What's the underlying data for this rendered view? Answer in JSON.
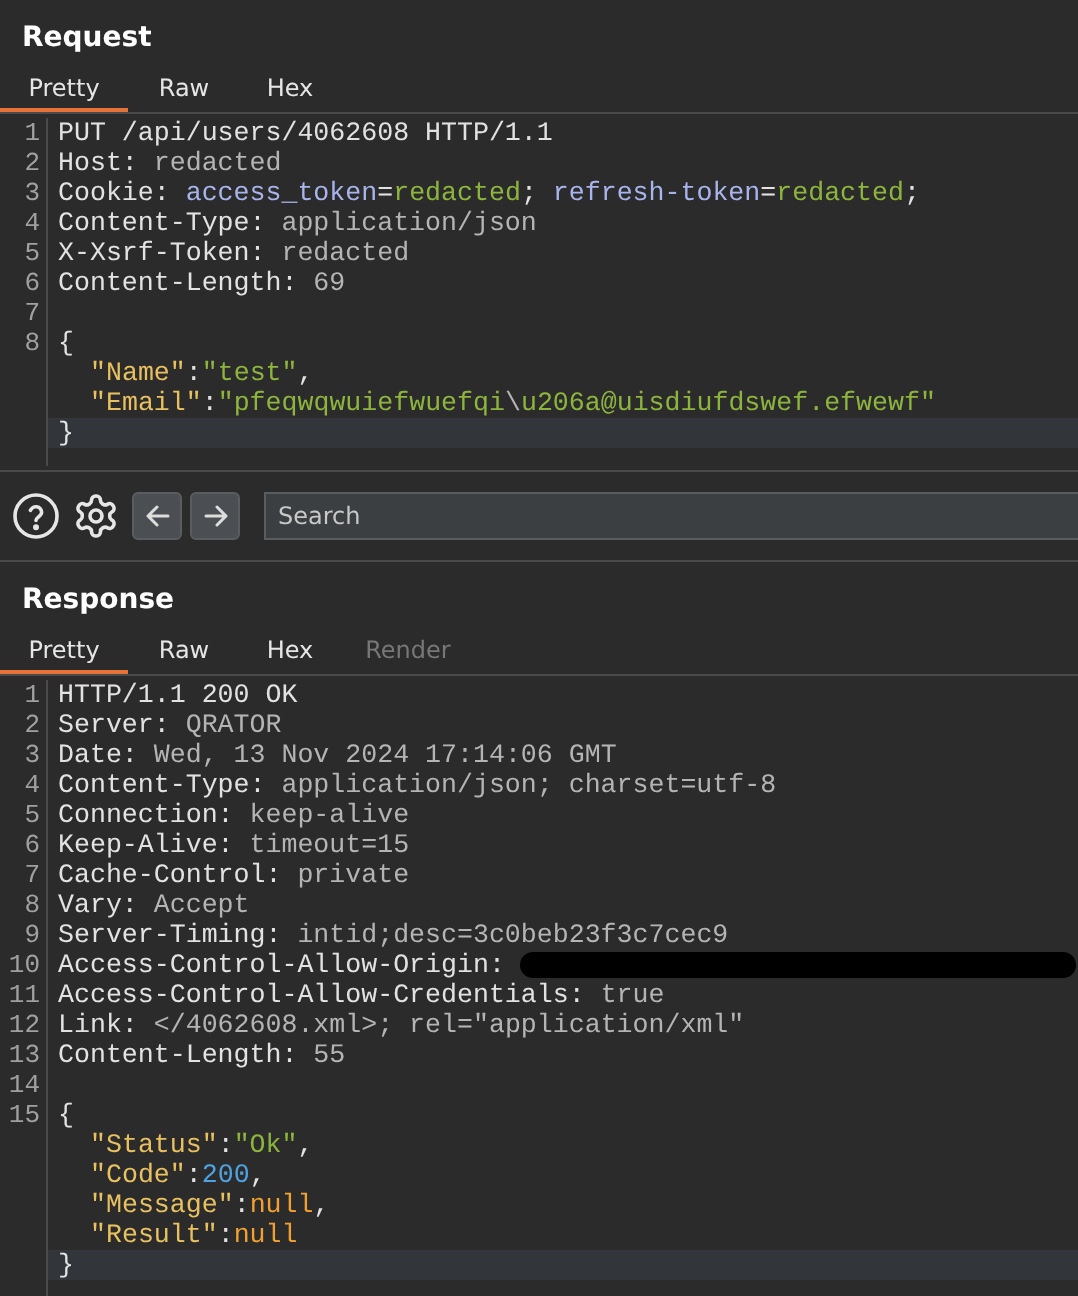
{
  "request": {
    "title": "Request",
    "tabs": [
      {
        "label": "Pretty",
        "selected": true,
        "disabled": false
      },
      {
        "label": "Raw",
        "selected": false,
        "disabled": false
      },
      {
        "label": "Hex",
        "selected": false,
        "disabled": false
      }
    ],
    "lines": [
      {
        "number": "1",
        "current": false,
        "indent": false,
        "segments": [
          {
            "kind": "key",
            "text": "PUT /api/users/4062608 HTTP/1.1"
          }
        ]
      },
      {
        "number": "2",
        "current": false,
        "indent": false,
        "segments": [
          {
            "kind": "key",
            "text": "Host: "
          },
          {
            "kind": "value",
            "text": "redacted"
          }
        ]
      },
      {
        "number": "3",
        "current": false,
        "indent": false,
        "segments": [
          {
            "kind": "key",
            "text": "Cookie: "
          },
          {
            "kind": "param",
            "text": "access_token"
          },
          {
            "kind": "key",
            "text": "="
          },
          {
            "kind": "string",
            "text": "redacted"
          },
          {
            "kind": "key",
            "text": "; "
          },
          {
            "kind": "param",
            "text": "refresh-token"
          },
          {
            "kind": "key",
            "text": "="
          },
          {
            "kind": "string",
            "text": "redacted"
          },
          {
            "kind": "key",
            "text": ";"
          }
        ]
      },
      {
        "number": "4",
        "current": false,
        "indent": false,
        "segments": [
          {
            "kind": "key",
            "text": "Content-Type: "
          },
          {
            "kind": "value",
            "text": "application/json"
          }
        ]
      },
      {
        "number": "5",
        "current": false,
        "indent": false,
        "segments": [
          {
            "kind": "key",
            "text": "X-Xsrf-Token: "
          },
          {
            "kind": "value",
            "text": "redacted"
          }
        ]
      },
      {
        "number": "6",
        "current": false,
        "indent": false,
        "segments": [
          {
            "kind": "key",
            "text": "Content-Length: "
          },
          {
            "kind": "value",
            "text": "69"
          }
        ]
      },
      {
        "number": "7",
        "current": false
      },
      {
        "number": "8",
        "current": false,
        "indent": false,
        "segments": [
          {
            "kind": "key",
            "text": "{"
          }
        ]
      },
      {
        "current": false,
        "indent": true,
        "segments": [
          {
            "kind": "name",
            "text": "\"Name\""
          },
          {
            "kind": "key",
            "text": ":"
          },
          {
            "kind": "string",
            "text": "\"test\""
          },
          {
            "kind": "key",
            "text": ","
          }
        ]
      },
      {
        "current": false,
        "indent": true,
        "segments": [
          {
            "kind": "name",
            "text": "\"Email\""
          },
          {
            "kind": "key",
            "text": ":"
          },
          {
            "kind": "string",
            "text": "\"pfeqwqwuiefwuefqi"
          },
          {
            "kind": "value",
            "text": "\\"
          },
          {
            "kind": "string",
            "text": "u206a@uisdiufdswef.efwewf\""
          }
        ]
      },
      {
        "current": true,
        "indent": false,
        "segments": [
          {
            "kind": "key",
            "text": "}"
          }
        ]
      }
    ]
  },
  "toolbar": {
    "search": {
      "placeholder": "Search"
    }
  },
  "response": {
    "title": "Response",
    "tabs": [
      {
        "label": "Pretty",
        "selected": true,
        "disabled": false
      },
      {
        "label": "Raw",
        "selected": false,
        "disabled": false
      },
      {
        "label": "Hex",
        "selected": false,
        "disabled": false
      },
      {
        "label": "Render",
        "selected": false,
        "disabled": true
      }
    ],
    "lines": [
      {
        "number": "1",
        "current": false,
        "indent": false,
        "segments": [
          {
            "kind": "key",
            "text": "HTTP/1.1 200 OK"
          }
        ]
      },
      {
        "number": "2",
        "current": false,
        "indent": false,
        "segments": [
          {
            "kind": "key",
            "text": "Server: "
          },
          {
            "kind": "value",
            "text": "QRATOR"
          }
        ]
      },
      {
        "number": "3",
        "current": false,
        "indent": false,
        "segments": [
          {
            "kind": "key",
            "text": "Date: "
          },
          {
            "kind": "value",
            "text": "Wed, 13 Nov 2024 17:14:06 GMT"
          }
        ]
      },
      {
        "number": "4",
        "current": false,
        "indent": false,
        "segments": [
          {
            "kind": "key",
            "text": "Content-Type: "
          },
          {
            "kind": "value",
            "text": "application/json; charset=utf-8"
          }
        ]
      },
      {
        "number": "5",
        "current": false,
        "indent": false,
        "segments": [
          {
            "kind": "key",
            "text": "Connection: "
          },
          {
            "kind": "value",
            "text": "keep-alive"
          }
        ]
      },
      {
        "number": "6",
        "current": false,
        "indent": false,
        "segments": [
          {
            "kind": "key",
            "text": "Keep-Alive: "
          },
          {
            "kind": "value",
            "text": "timeout=15"
          }
        ]
      },
      {
        "number": "7",
        "current": false,
        "indent": false,
        "segments": [
          {
            "kind": "key",
            "text": "Cache-Control: "
          },
          {
            "kind": "value",
            "text": "private"
          }
        ]
      },
      {
        "number": "8",
        "current": false,
        "indent": false,
        "segments": [
          {
            "kind": "key",
            "text": "Vary: "
          },
          {
            "kind": "value",
            "text": "Accept"
          }
        ]
      },
      {
        "number": "9",
        "current": false,
        "indent": false,
        "segments": [
          {
            "kind": "key",
            "text": "Server-Timing: "
          },
          {
            "kind": "value",
            "text": "intid;desc=3c0beb23f3c7cec9"
          }
        ]
      },
      {
        "number": "10",
        "current": false,
        "indent": false,
        "segments": [
          {
            "kind": "key",
            "text": "Access-Control-Allow-Origin: "
          },
          {
            "kind": "redaction"
          }
        ]
      },
      {
        "number": "11",
        "current": false,
        "indent": false,
        "segments": [
          {
            "kind": "key",
            "text": "Access-Control-Allow-Credentials: "
          },
          {
            "kind": "value",
            "text": "true"
          }
        ]
      },
      {
        "number": "12",
        "current": false,
        "indent": false,
        "segments": [
          {
            "kind": "key",
            "text": "Link: "
          },
          {
            "kind": "value",
            "text": "</4062608.xml>; rel=\"application/xml\""
          }
        ]
      },
      {
        "number": "13",
        "current": false,
        "indent": false,
        "segments": [
          {
            "kind": "key",
            "text": "Content-Length: "
          },
          {
            "kind": "value",
            "text": "55"
          }
        ]
      },
      {
        "number": "14",
        "current": false
      },
      {
        "number": "15",
        "current": false,
        "indent": false,
        "segments": [
          {
            "kind": "key",
            "text": "{"
          }
        ]
      },
      {
        "current": false,
        "indent": true,
        "segments": [
          {
            "kind": "name",
            "text": "\"Status\""
          },
          {
            "kind": "key",
            "text": ":"
          },
          {
            "kind": "string",
            "text": "\"Ok\""
          },
          {
            "kind": "key",
            "text": ","
          }
        ]
      },
      {
        "current": false,
        "indent": true,
        "segments": [
          {
            "kind": "name",
            "text": "\"Code\""
          },
          {
            "kind": "key",
            "text": ":"
          },
          {
            "kind": "number",
            "text": "200"
          },
          {
            "kind": "key",
            "text": ","
          }
        ]
      },
      {
        "current": false,
        "indent": true,
        "segments": [
          {
            "kind": "name",
            "text": "\"Message\""
          },
          {
            "kind": "key",
            "text": ":"
          },
          {
            "kind": "null",
            "text": "null"
          },
          {
            "kind": "key",
            "text": ","
          }
        ]
      },
      {
        "current": false,
        "indent": true,
        "segments": [
          {
            "kind": "name",
            "text": "\"Result\""
          },
          {
            "kind": "key",
            "text": ":"
          },
          {
            "kind": "null",
            "text": "null"
          }
        ]
      },
      {
        "current": true,
        "indent": false,
        "segments": [
          {
            "kind": "key",
            "text": "}"
          }
        ]
      }
    ]
  }
}
